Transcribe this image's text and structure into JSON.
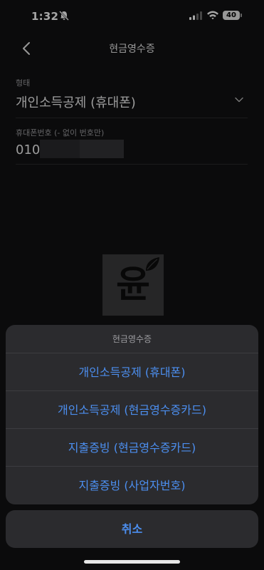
{
  "status": {
    "time": "1:32",
    "battery": "40"
  },
  "header": {
    "title": "현금영수증"
  },
  "form": {
    "type_label": "형태",
    "type_value": "개인소득공제 (휴대폰)",
    "phone_label": "휴대폰번호 (- 없이 번호만)",
    "phone_value": "010"
  },
  "logo": {
    "text": "윤"
  },
  "action_sheet": {
    "title": "현금영수증",
    "options": [
      "개인소득공제 (휴대폰)",
      "개인소득공제 (현금영수증카드)",
      "지출증빙 (현금영수증카드)",
      "지출증빙 (사업자번호)"
    ],
    "cancel": "취소"
  },
  "colors": {
    "accent": "#4c8ff0",
    "sheet_bg": "#2b2b2e",
    "background": "#111113"
  },
  "icons": [
    "bell-slash-icon",
    "signal-icon",
    "wifi-icon",
    "battery-icon",
    "back-chevron-icon",
    "chevron-down-icon",
    "leaf-icon"
  ]
}
